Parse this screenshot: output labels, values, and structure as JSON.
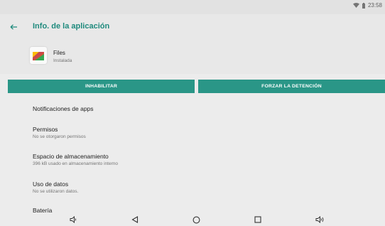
{
  "status_bar": {
    "time": "23:58",
    "icons": [
      "wifi-icon",
      "battery-icon"
    ]
  },
  "header": {
    "back_icon": "arrow-left-icon",
    "title": "Info. de la aplicación"
  },
  "app": {
    "name": "Files",
    "status": "Instalada",
    "icon": "files-app-icon"
  },
  "actions": {
    "disable_label": "INHABILITAR",
    "force_stop_label": "FORZAR LA DETENCIÓN"
  },
  "settings": {
    "notifications": {
      "title": "Notificaciones de apps"
    },
    "permissions": {
      "title": "Permisos",
      "subtitle": "No se otorgaron permisos"
    },
    "storage": {
      "title": "Espacio de almacenamiento",
      "subtitle": "396 kB usado en almacenamiento interno"
    },
    "data_usage": {
      "title": "Uso de datos",
      "subtitle": "No se utilizaron datos."
    },
    "battery": {
      "title": "Batería"
    }
  },
  "nav_bar": {
    "icons": [
      "volume-down-icon",
      "back-triangle-icon",
      "home-circle-icon",
      "recents-square-icon",
      "volume-up-icon"
    ]
  },
  "colors": {
    "accent": "#1f8a7d",
    "button": "#2a9687",
    "background": "#ececec"
  }
}
